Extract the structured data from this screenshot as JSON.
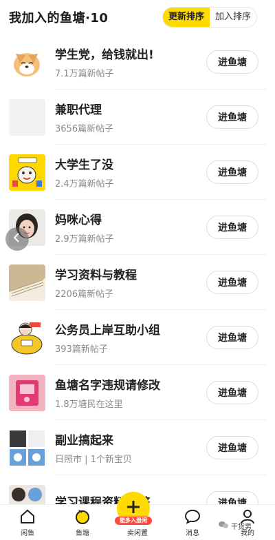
{
  "header": {
    "title": "我加入的鱼塘·10",
    "sort_update": "更新排序",
    "sort_join": "加入排序"
  },
  "enter_label": "进鱼塘",
  "ponds": [
    {
      "name": "学生党，给钱就出!",
      "sub": "7.1万篇新帖子"
    },
    {
      "name": "兼职代理",
      "sub": "3656篇新帖子"
    },
    {
      "name": "大学生了没",
      "sub": "2.4万篇新帖子"
    },
    {
      "name": "妈咪心得",
      "sub": "2.9万篇新帖子"
    },
    {
      "name": "学习资料与教程",
      "sub": "2206篇新帖子"
    },
    {
      "name": "公务员上岸互助小组",
      "sub": "393篇新帖子"
    },
    {
      "name": "鱼塘名字违规请修改",
      "sub": "1.8万塘民在这里"
    },
    {
      "name": "副业搞起来",
      "sub": "日照市 | 1个新宝贝"
    },
    {
      "name": "学习课程资料...整",
      "sub": ""
    }
  ],
  "bottom_nav": {
    "home": "闲鱼",
    "pond": "鱼塘",
    "sell": "卖闲置",
    "sell_badge": "能多入册闲",
    "messages": "消息",
    "mine": "我的"
  },
  "watermark": "干货男",
  "colors": {
    "accent": "#ffda00",
    "badge": "#ff4a3d"
  }
}
